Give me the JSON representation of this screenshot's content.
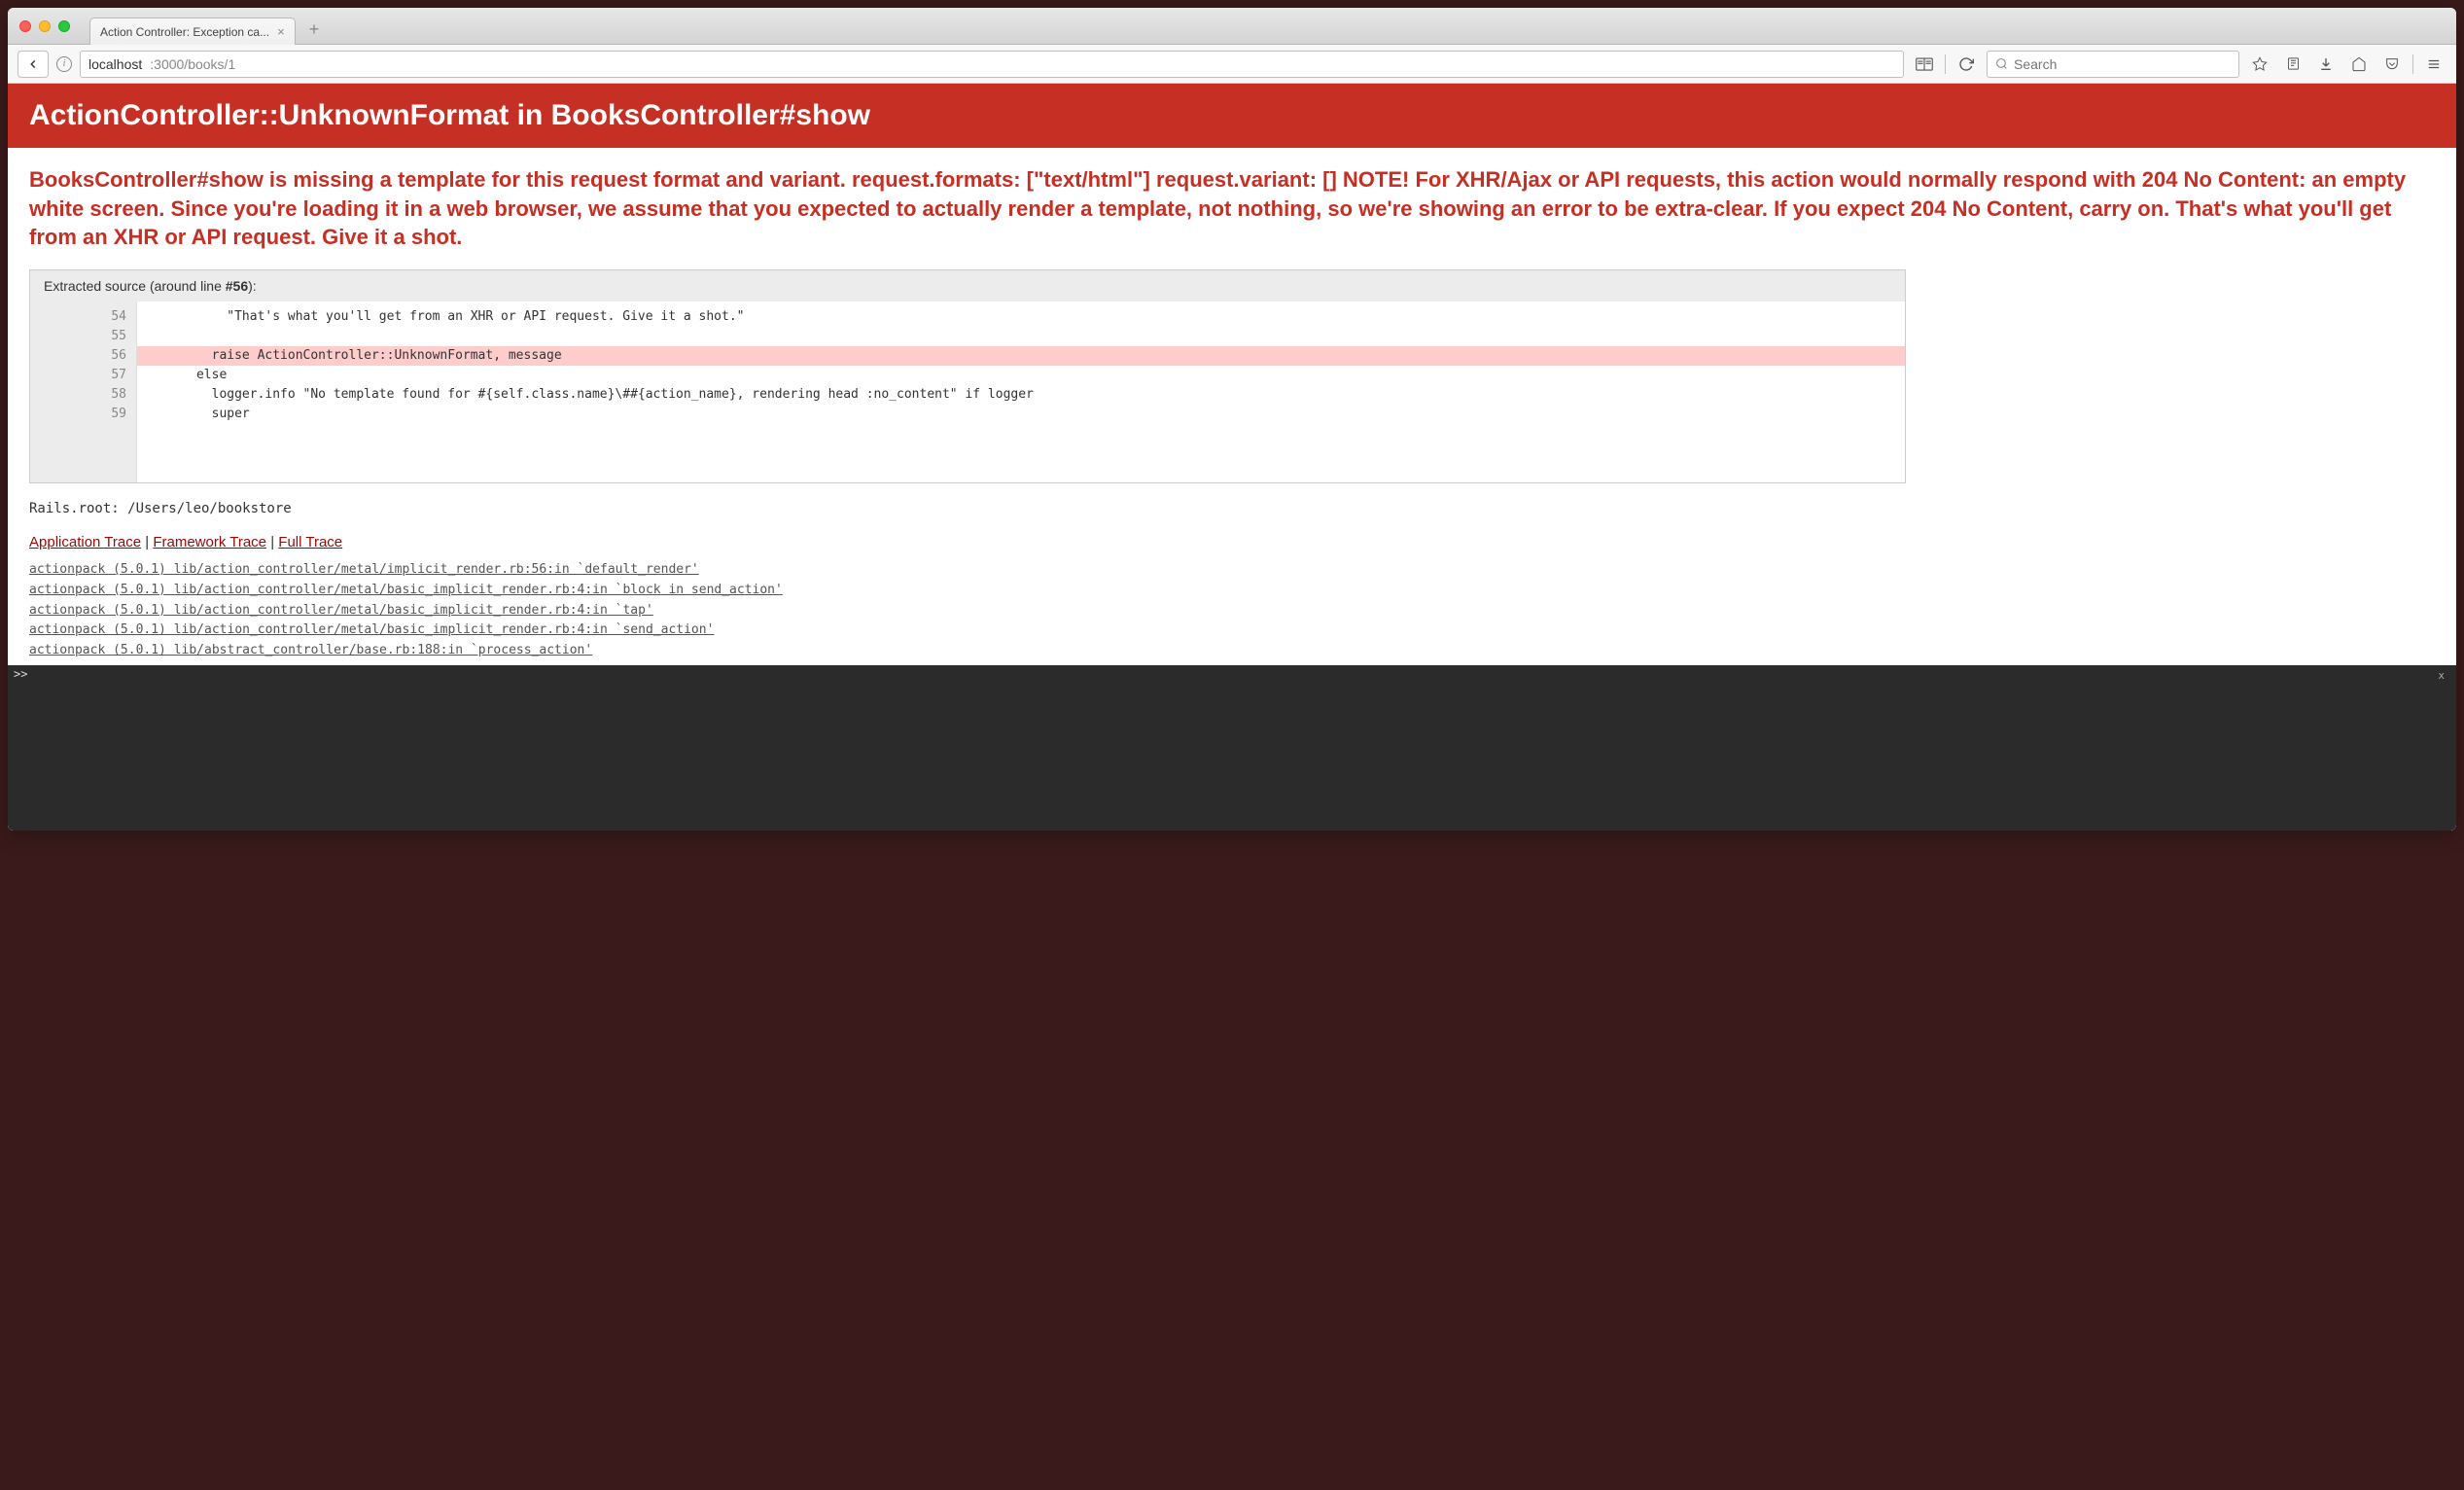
{
  "window": {
    "tab_title": "Action Controller: Exception ca...",
    "new_tab_tooltip": "+"
  },
  "toolbar": {
    "url_host": "localhost",
    "url_rest": ":3000/books/1",
    "search_placeholder": "Search"
  },
  "error": {
    "title": "ActionController::UnknownFormat in BooksController#show",
    "message": "BooksController#show is missing a template for this request format and variant. request.formats: [\"text/html\"] request.variant: [] NOTE! For XHR/Ajax or API requests, this action would normally respond with 204 No Content: an empty white screen. Since you're loading it in a web browser, we assume that you expected to actually render a template, not nothing, so we're showing an error to be extra-clear. If you expect 204 No Content, carry on. That's what you'll get from an XHR or API request. Give it a shot."
  },
  "source": {
    "title_prefix": "Extracted source (around line ",
    "highlight_line": "#56",
    "title_suffix": "):",
    "lines": [
      {
        "no": "54",
        "code": "          \"That's what you'll get from an XHR or API request. Give it a shot.\"",
        "hl": false
      },
      {
        "no": "55",
        "code": "",
        "hl": false
      },
      {
        "no": "56",
        "code": "        raise ActionController::UnknownFormat, message",
        "hl": true
      },
      {
        "no": "57",
        "code": "      else",
        "hl": false
      },
      {
        "no": "58",
        "code": "        logger.info \"No template found for #{self.class.name}\\##{action_name}, rendering head :no_content\" if logger",
        "hl": false
      },
      {
        "no": "59",
        "code": "        super",
        "hl": false
      }
    ]
  },
  "rails_root": "Rails.root: /Users/leo/bookstore",
  "trace_tabs": {
    "app": "Application Trace",
    "framework": "Framework Trace",
    "full": "Full Trace"
  },
  "trace_lines": [
    "actionpack (5.0.1) lib/action_controller/metal/implicit_render.rb:56:in `default_render'",
    "actionpack (5.0.1) lib/action_controller/metal/basic_implicit_render.rb:4:in `block in send_action'",
    "actionpack (5.0.1) lib/action_controller/metal/basic_implicit_render.rb:4:in `tap'",
    "actionpack (5.0.1) lib/action_controller/metal/basic_implicit_render.rb:4:in `send_action'",
    "actionpack (5.0.1) lib/abstract_controller/base.rb:188:in `process_action'"
  ],
  "console": {
    "prompt": ">>",
    "close": "x"
  }
}
